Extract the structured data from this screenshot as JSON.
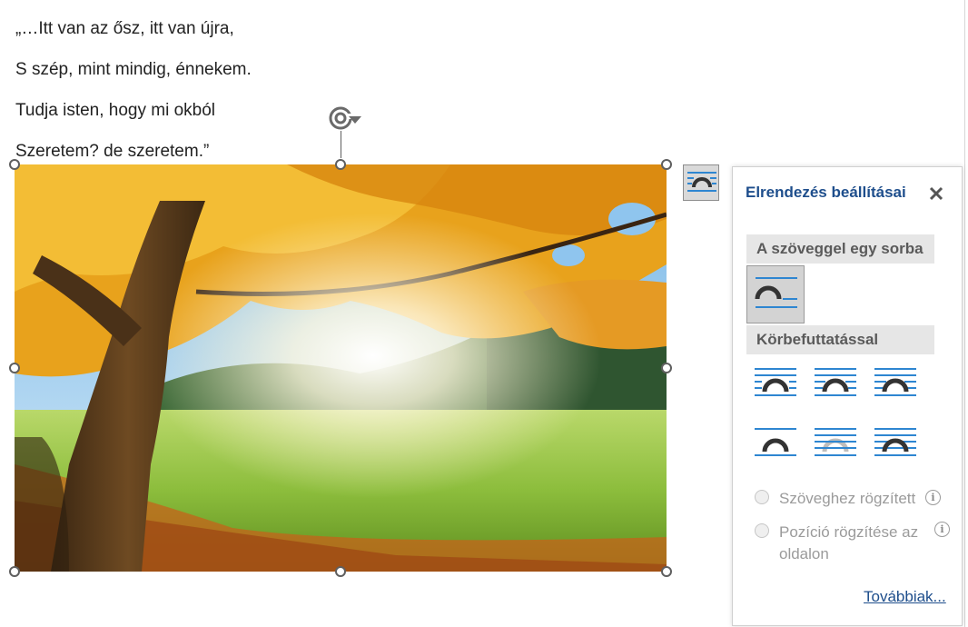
{
  "document": {
    "lines": [
      "„…Itt van az ősz, itt van újra,",
      "S szép, mint mindig, énnekem.",
      "Tudja isten, hogy mi okból",
      "Szeretem? de szeretem.”"
    ]
  },
  "image": {
    "subject": "autumn tree in sunlit meadow"
  },
  "layout_panel": {
    "title": "Elrendezés beállításai",
    "section_inline": "A szöveggel egy sorba",
    "section_wrap": "Körbefuttatással",
    "radio_move_with_text": "Szöveghez rögzített",
    "radio_fix_position": "Pozíció rögzítése az oldalon",
    "more_link": "Továbbiak..."
  },
  "colors": {
    "accent": "#1e4e8c",
    "wrap_line": "#2e86d1",
    "icon_arc": "#333333"
  },
  "icons": {
    "close": "close-icon",
    "rotate": "rotate-icon",
    "info": "info-icon"
  }
}
